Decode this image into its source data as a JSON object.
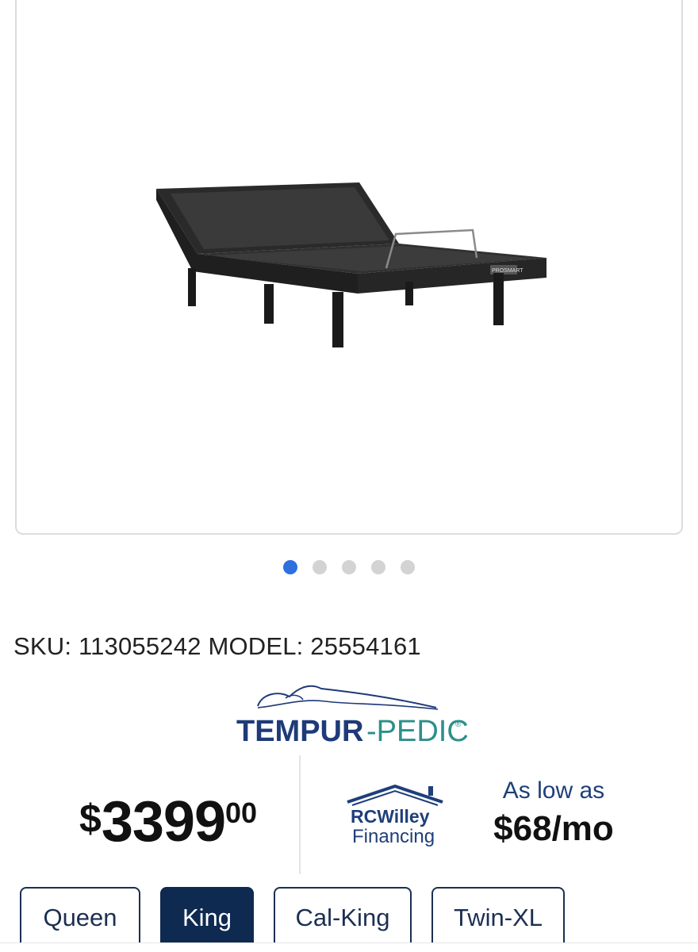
{
  "product_image": {
    "alt": "Tempur-Pedic adjustable base",
    "base_label": "PROSMART"
  },
  "carousel": {
    "count": 5,
    "active_index": 0,
    "active_color": "#2f6fe0"
  },
  "sku_line": "SKU: 113055242 MODEL: 25554161",
  "brand": {
    "name_left": "TEMPUR",
    "name_right": "-PEDIC",
    "reg": "®",
    "color_left": "#1e3a78",
    "color_right": "#2d8f8a"
  },
  "price": {
    "dollar": "$",
    "whole": "3399",
    "cents": "00"
  },
  "financing": {
    "logo_line1": "RCWilley",
    "logo_line2": "Financing",
    "as_low_as": "As low as",
    "monthly": "$68/mo"
  },
  "sizes": [
    {
      "label": "Queen",
      "selected": false
    },
    {
      "label": "King",
      "selected": true
    },
    {
      "label": "Cal-King",
      "selected": false
    },
    {
      "label": "Twin-XL",
      "selected": false
    }
  ]
}
